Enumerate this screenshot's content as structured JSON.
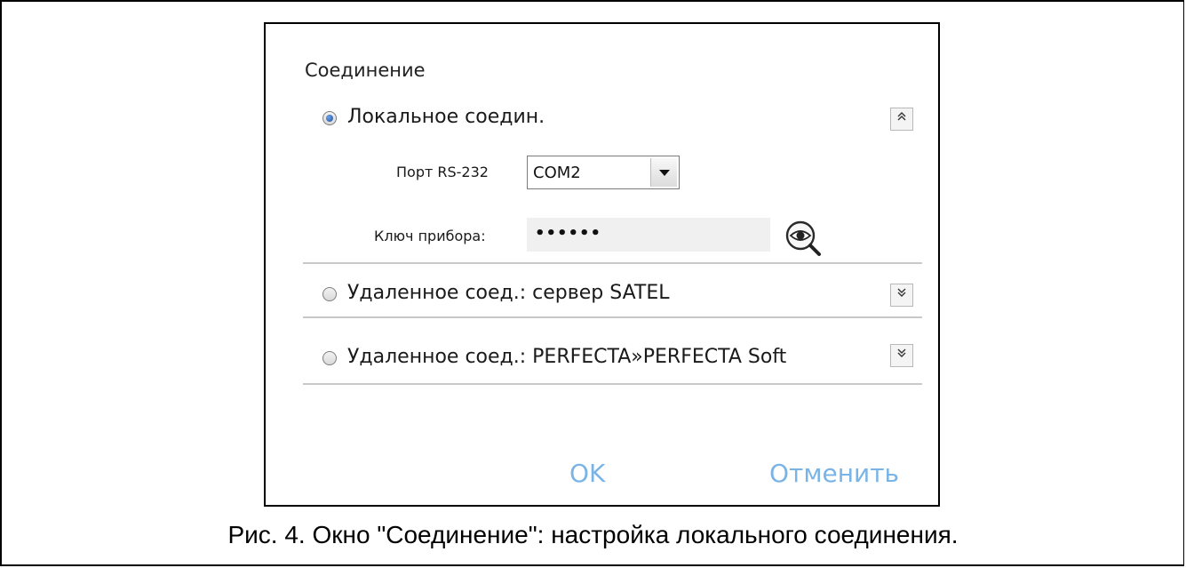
{
  "dialog": {
    "title": "Соединение",
    "local": {
      "label": "Локальное соедин.",
      "selected": true,
      "toggle_icon": "double-chevron-up",
      "port_label": "Порт RS-232",
      "port_value": "COM2",
      "key_label": "Ключ прибора:",
      "key_value": "••••••",
      "reveal_icon": "eye-magnifier"
    },
    "remote_satel": {
      "label": "Удаленное соед.: сервер SATEL",
      "selected": false,
      "toggle_icon": "double-chevron-down"
    },
    "remote_perfecta": {
      "label": "Удаленное соед.: PERFECTA»PERFECTA Soft",
      "selected": false,
      "toggle_icon": "double-chevron-down"
    },
    "ok_label": "OK",
    "cancel_label": "Отменить"
  },
  "caption": "Рис. 4. Окно \"Соединение\": настройка локального соединения.",
  "colors": {
    "button_text": "#7ab4e6",
    "divider": "#c8c8c8",
    "radio_dot": "#1f4f9e"
  }
}
